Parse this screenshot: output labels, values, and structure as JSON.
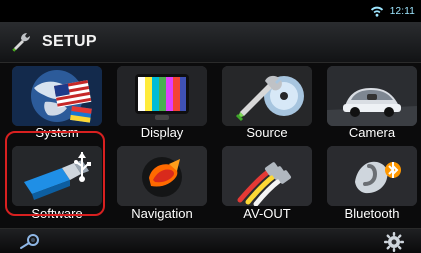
{
  "status": {
    "time": "12:11",
    "wifi_icon": "wifi-icon"
  },
  "header": {
    "title": "SETUP",
    "icon": "wrench-icon"
  },
  "tiles": [
    {
      "label": "System",
      "icon": "world-flags-icon"
    },
    {
      "label": "Display",
      "icon": "tv-color-bars-icon"
    },
    {
      "label": "Source",
      "icon": "source-cd-wrench-icon"
    },
    {
      "label": "Camera",
      "icon": "car-camera-icon"
    },
    {
      "label": "Software",
      "icon": "usb-stick-icon",
      "selected": true
    },
    {
      "label": "Navigation",
      "icon": "navigation-arrow-icon"
    },
    {
      "label": "AV-OUT",
      "icon": "av-cables-icon"
    },
    {
      "label": "Bluetooth",
      "icon": "bluetooth-icon"
    }
  ],
  "bottom": {
    "search_icon": "search-icon",
    "settings_icon": "gear-icon"
  },
  "colors": {
    "highlight": "#d82020",
    "clock": "#9ee6ff"
  }
}
